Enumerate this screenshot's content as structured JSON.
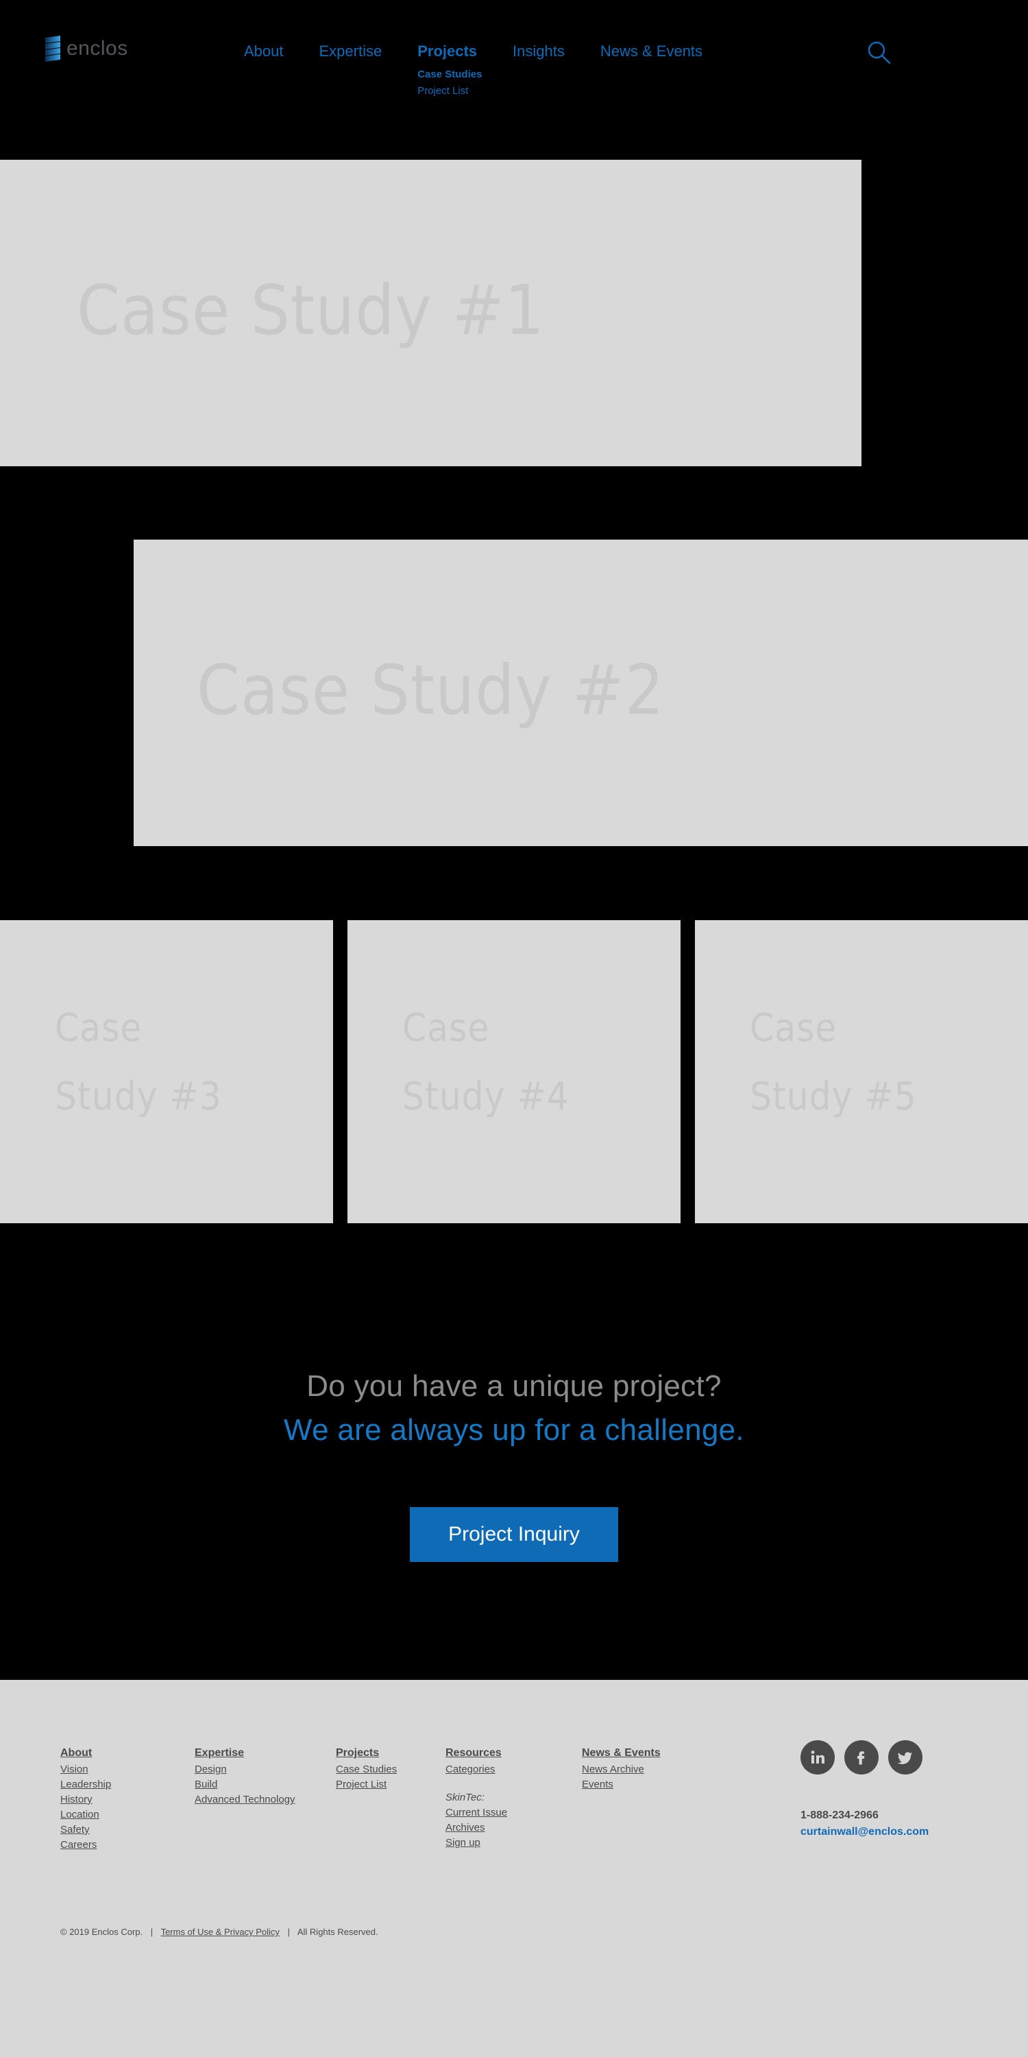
{
  "colors": {
    "background": "#000000",
    "accent_blue": "#0f6bb5",
    "placeholder_gray": "#d9d9d9",
    "placeholder_text": "#c9c9c9",
    "footer_bg": "#d8d8d8",
    "footer_text": "#4a4a4a",
    "logo_gray": "#54565b"
  },
  "header": {
    "logo": {
      "wordmark": "enclos",
      "mark_name": "enclos-bars-logo"
    },
    "nav": [
      {
        "label": "About",
        "active": false
      },
      {
        "label": "Expertise",
        "active": false
      },
      {
        "label": "Projects",
        "active": true,
        "submenu": [
          {
            "label": "Case Studies",
            "current": true
          },
          {
            "label": "Project List",
            "current": false
          }
        ]
      },
      {
        "label": "Insights",
        "active": false
      },
      {
        "label": "News & Events",
        "active": false
      }
    ],
    "search": {
      "icon": "search-icon",
      "aria_label": "Search"
    }
  },
  "case_studies": [
    {
      "id": "cs1",
      "label": "Case Study #1"
    },
    {
      "id": "cs2",
      "label": "Case Study #2"
    },
    {
      "id": "cs3",
      "label": "Case\nStudy #3"
    },
    {
      "id": "cs4",
      "label": "Case\nStudy #4"
    },
    {
      "id": "cs5",
      "label": "Case\nStudy #5"
    }
  ],
  "cta": {
    "line1": "Do you have a unique project?",
    "line2": "We are always up for a challenge.",
    "button_label": "Project Inquiry"
  },
  "footer": {
    "columns": [
      {
        "title": "About",
        "links": [
          "Vision",
          "Leadership",
          "History",
          "Location",
          "Safety",
          "Careers"
        ]
      },
      {
        "title": "Expertise",
        "links": [
          "Design",
          "Build",
          "Advanced Technology"
        ]
      },
      {
        "title": "Projects",
        "links": [
          "Case Studies",
          "Project List"
        ]
      },
      {
        "title": "Resources",
        "links": [
          "Categories"
        ],
        "subheading": "SkinTec:",
        "sublinks": [
          "Current Issue",
          "Archives",
          "Sign up"
        ]
      },
      {
        "title": "News & Events",
        "links": [
          "News Archive",
          "Events"
        ]
      }
    ],
    "social": [
      {
        "name": "linkedin-icon",
        "label": "LinkedIn"
      },
      {
        "name": "facebook-icon",
        "label": "Facebook"
      },
      {
        "name": "twitter-icon",
        "label": "Twitter"
      }
    ],
    "contact": {
      "phone": "1-888-234-2966",
      "email": "curtainwall@enclos.com"
    },
    "copyright": {
      "left": "© 2019 Enclos Corp.",
      "terms": "Terms of Use & Privacy Policy",
      "right": "All Rights Reserved.",
      "separator": "|"
    }
  }
}
